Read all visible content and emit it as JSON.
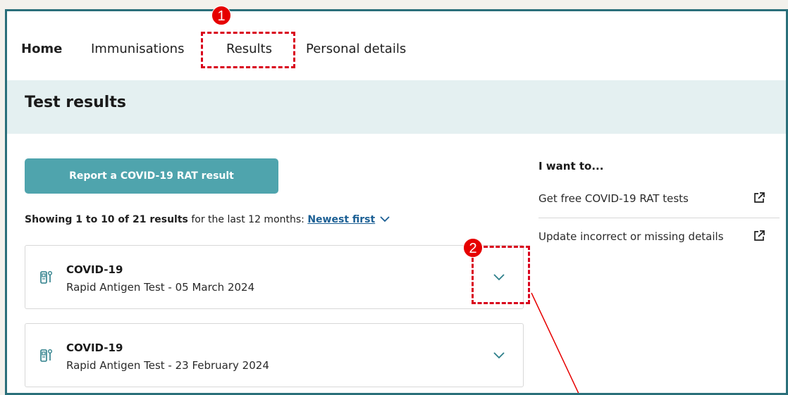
{
  "nav": {
    "home": "Home",
    "immunisations": "Immunisations",
    "results": "Results",
    "personal_details": "Personal details"
  },
  "annotations": {
    "step1": "1",
    "step2": "2"
  },
  "header": {
    "title": "Test results"
  },
  "main": {
    "report_button": "Report a COVID-19 RAT result",
    "showing_bold": "Showing 1 to 10 of 21 results",
    "showing_rest": " for the last 12 months: ",
    "sort_label": "Newest first",
    "results": [
      {
        "title": "COVID-19",
        "subtitle": "Rapid Antigen Test - 05 March 2024",
        "icon": "test-kit-icon"
      },
      {
        "title": "COVID-19",
        "subtitle": "Rapid Antigen Test - 23 February 2024",
        "icon": "test-kit-icon"
      }
    ]
  },
  "side": {
    "title": "I want to...",
    "links": [
      {
        "label": "Get free COVID-19 RAT tests",
        "icon": "external-link-icon"
      },
      {
        "label": "Update incorrect or missing details",
        "icon": "external-link-icon"
      }
    ]
  },
  "colors": {
    "accent": "#4fa4ad",
    "band": "#e4f0f1",
    "frame": "#2a6f7a",
    "link": "#1b5f94",
    "annotation": "#e60000"
  }
}
